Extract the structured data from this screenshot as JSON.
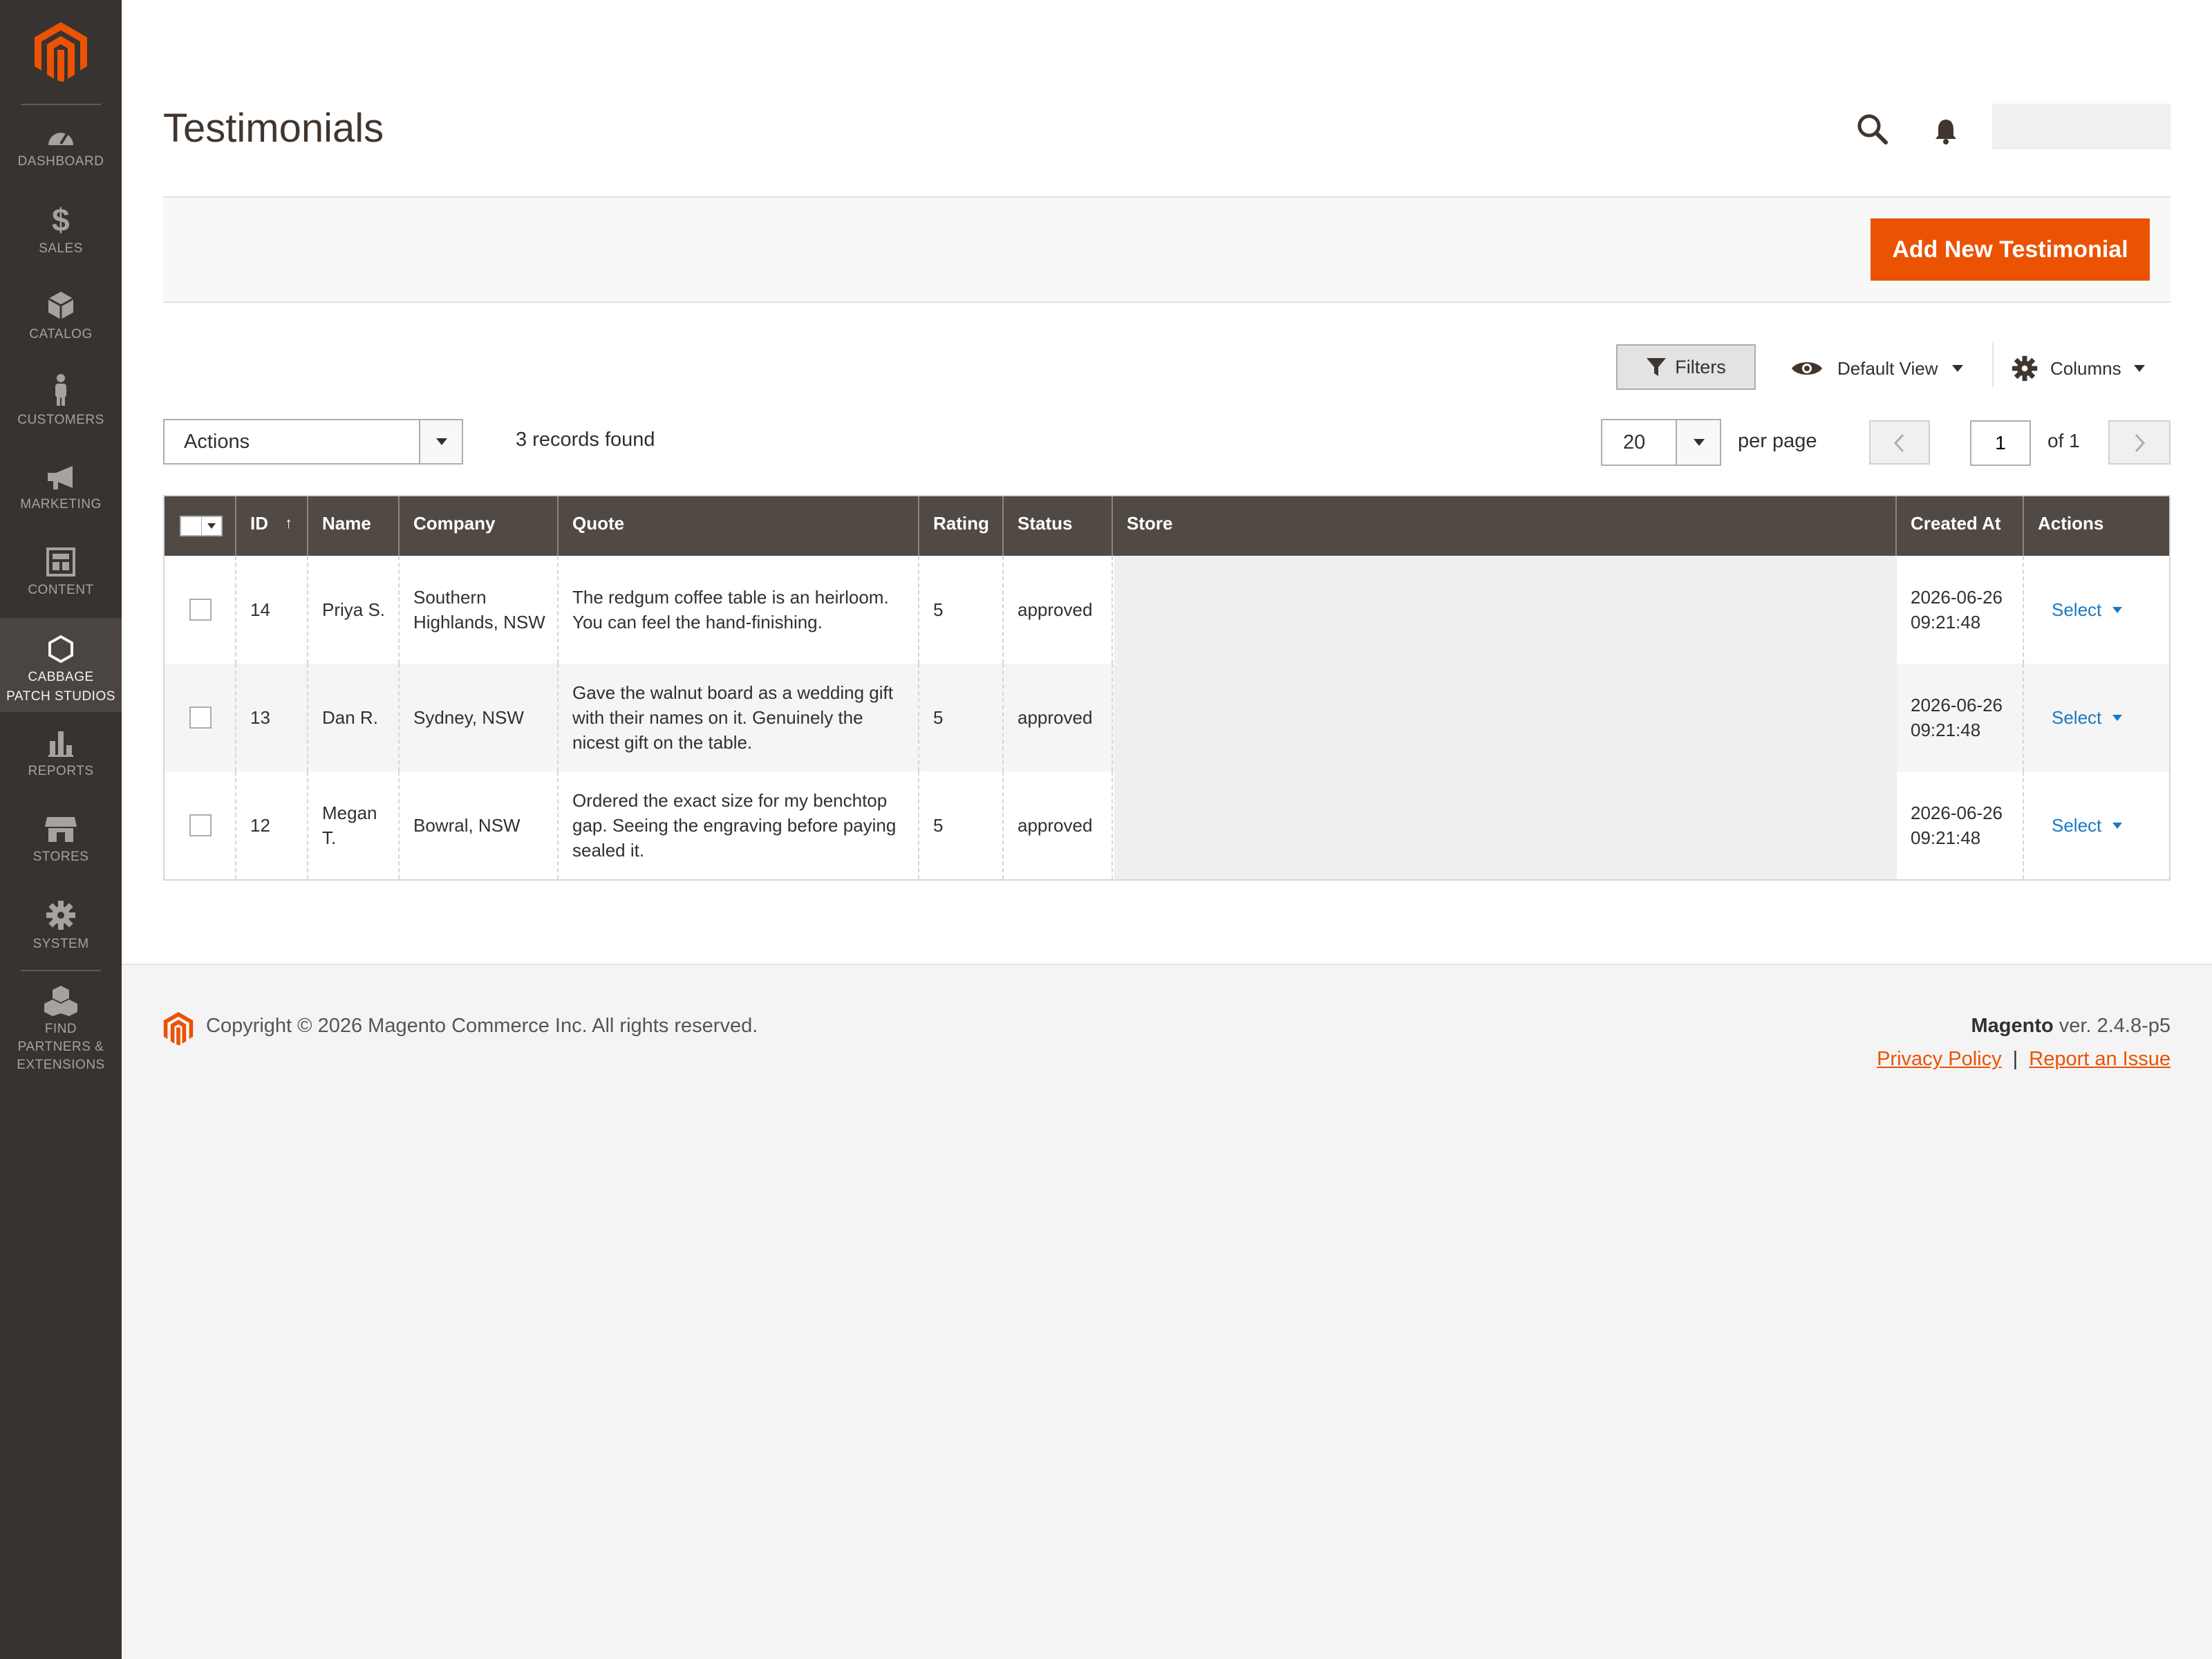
{
  "sidebar": {
    "items": [
      {
        "label": "DASHBOARD",
        "icon": "dashboard-icon"
      },
      {
        "label": "SALES",
        "icon": "dollar-icon"
      },
      {
        "label": "CATALOG",
        "icon": "box-icon"
      },
      {
        "label": "CUSTOMERS",
        "icon": "person-icon"
      },
      {
        "label": "MARKETING",
        "icon": "megaphone-icon"
      },
      {
        "label": "CONTENT",
        "icon": "layout-icon"
      },
      {
        "label_line1": "CABBAGE",
        "label_line2": "PATCH STUDIOS",
        "icon": "hexagon-icon",
        "active": true
      },
      {
        "label": "REPORTS",
        "icon": "bar-chart-icon"
      },
      {
        "label": "STORES",
        "icon": "storefront-icon"
      },
      {
        "label": "SYSTEM",
        "icon": "gear-icon"
      },
      {
        "label_line1": "FIND",
        "label_line2": "PARTNERS &",
        "label_line3": "EXTENSIONS",
        "icon": "cubes-icon"
      }
    ]
  },
  "header": {
    "title": "Testimonials",
    "add_button": "Add New Testimonial"
  },
  "toolbar": {
    "filters": "Filters",
    "view": "Default View",
    "columns": "Columns",
    "actions": "Actions",
    "records": "3 records found",
    "per_page_value": "20",
    "per_page_label": "per page",
    "page": "1",
    "page_of": "of 1"
  },
  "grid": {
    "columns": [
      "ID",
      "Name",
      "Company",
      "Quote",
      "Rating",
      "Status",
      "Store",
      "Created At",
      "Actions"
    ],
    "sort_arrow": "↑",
    "rows": [
      {
        "id": "14",
        "name": "Priya S.",
        "company": "Southern Highlands, NSW",
        "quote": "The redgum coffee table is an heirloom. You can feel the hand-finishing.",
        "rating": "5",
        "status": "approved",
        "created": "2026-06-26 09:21:48",
        "action": "Select"
      },
      {
        "id": "13",
        "name": "Dan R.",
        "company": "Sydney, NSW",
        "quote": "Gave the walnut board as a wedding gift with their names on it. Genuinely the nicest gift on the table.",
        "rating": "5",
        "status": "approved",
        "created": "2026-06-26 09:21:48",
        "action": "Select"
      },
      {
        "id": "12",
        "name": "Megan T.",
        "company": "Bowral, NSW",
        "quote": "Ordered the exact size for my benchtop gap. Seeing the engraving before paying sealed it.",
        "rating": "5",
        "status": "approved",
        "created": "2026-06-26 09:21:48",
        "action": "Select"
      }
    ]
  },
  "footer": {
    "copyright": "Copyright © 2026 Magento Commerce Inc. All rights reserved.",
    "brand": "Magento",
    "version": " ver. 2.4.8-p5",
    "privacy": "Privacy Policy",
    "separator": "|",
    "report": "Report an Issue"
  },
  "colors": {
    "sidebar_bg": "#373330",
    "accent": "#eb5202",
    "grid_header": "#514943",
    "link": "#1979c3"
  }
}
